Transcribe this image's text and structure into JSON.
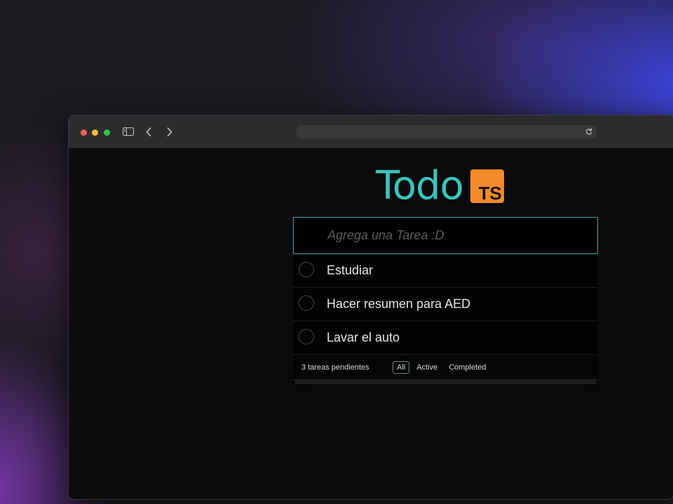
{
  "app": {
    "title": "Todo",
    "badge": "TS"
  },
  "input": {
    "value": "",
    "placeholder": "Agrega una Tarea :D"
  },
  "todos": [
    {
      "label": "Estudiar",
      "completed": false
    },
    {
      "label": "Hacer resumen para AED",
      "completed": false
    },
    {
      "label": "Lavar el auto",
      "completed": false
    }
  ],
  "footer": {
    "count_text": "3 tareas pendientes",
    "filters": [
      {
        "label": "All",
        "selected": true
      },
      {
        "label": "Active",
        "selected": false
      },
      {
        "label": "Completed",
        "selected": false
      }
    ]
  },
  "colors": {
    "accent": "#3bc4c0",
    "badge": "#f58a2b",
    "close": "#fe5f57",
    "minimize": "#febc2e",
    "maximize": "#28c840"
  },
  "browser_icons": [
    "sidebar-icon",
    "chevron-left-icon",
    "chevron-right-icon",
    "reload-icon"
  ]
}
